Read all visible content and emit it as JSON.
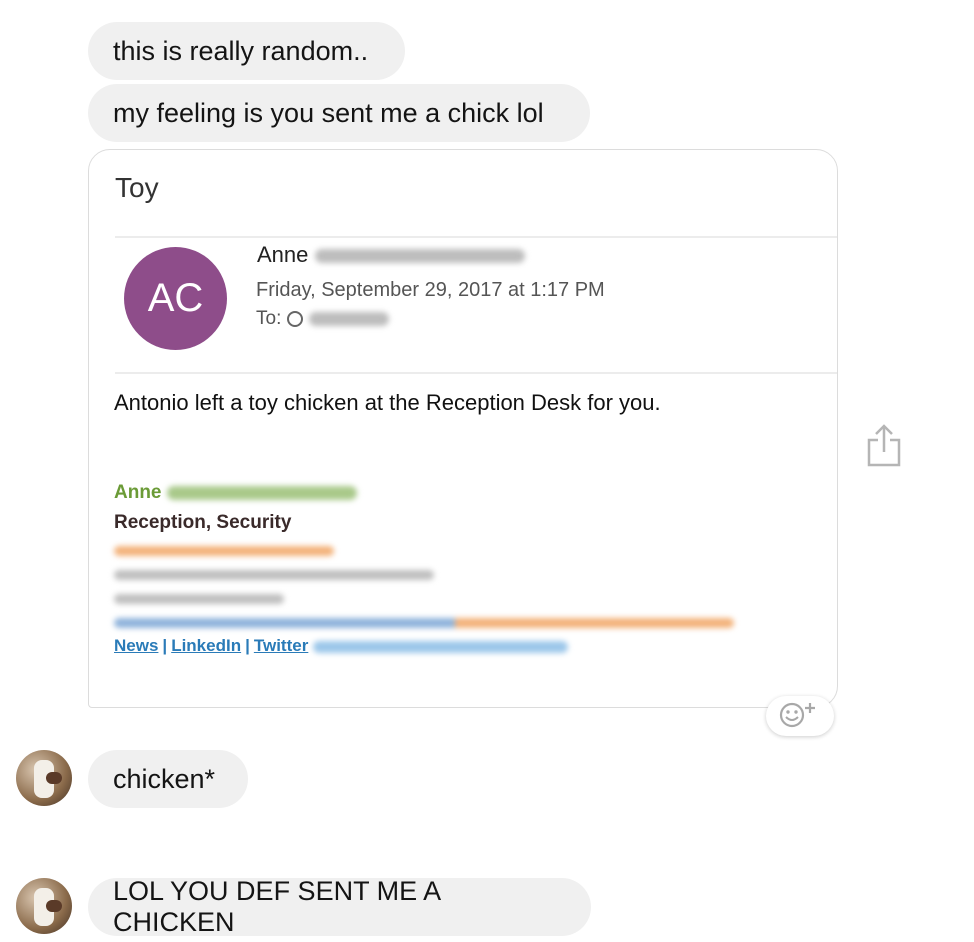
{
  "messages": {
    "m1": "this is really random..",
    "m2": "my feeling is you sent me a chick lol",
    "m3": "chicken*",
    "m4": "LOL YOU DEF SENT ME A CHICKEN"
  },
  "email_card": {
    "title": "Toy",
    "avatar_initials": "AC",
    "sender_first_name": "Anne",
    "date": "Friday, September 29, 2017 at 1:17 PM",
    "to_label": "To:",
    "body": "Antonio left a toy chicken at the Reception Desk for you.",
    "signature": {
      "name": "Anne",
      "role": "Reception, Security",
      "links": [
        "News",
        "LinkedIn",
        "Twitter"
      ]
    },
    "colors": {
      "avatar": "#8e4d8a",
      "signature_name": "#6b9b37",
      "link": "#2a7bb8"
    }
  },
  "icons": {
    "share": "share-icon",
    "reaction": "add-reaction-icon"
  }
}
